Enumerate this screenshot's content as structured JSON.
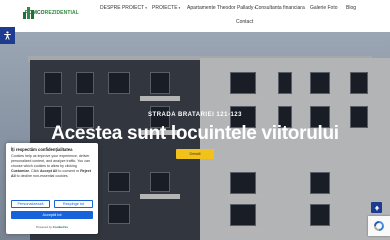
{
  "brand": {
    "logo_text_1": "ROMCO",
    "logo_text_2": "REZIDENTIAL"
  },
  "nav": {
    "items": [
      {
        "label": "DESPRE PROIECT",
        "has_caret": true
      },
      {
        "label": "PROIECTE",
        "has_caret": true
      },
      {
        "label": "Apartamente Theodor Pallady",
        "has_caret": true
      },
      {
        "label": "Consultanta financiara",
        "has_caret": false
      },
      {
        "label": "Galerie Foto",
        "has_caret": false
      },
      {
        "label": "Blog",
        "has_caret": false
      },
      {
        "label": "Contact",
        "has_caret": false
      }
    ]
  },
  "hero": {
    "subtitle": "STRADA BRATARIEI 121-123",
    "title": "Acestea sunt locuintele viitorului",
    "button_label": "Detalii"
  },
  "cookie": {
    "title": "Îți respectăm confidențialitatea",
    "text_1": "Cookies help us improve your experience, deliver personalized content, and analyze traffic. You can choose which cookies to allow by clicking ",
    "text_customize": "Customize",
    "text_2": ". Click ",
    "text_accept": "Accept All",
    "text_3": " to consent or ",
    "text_reject": "Reject All",
    "text_4": " to decline non-essential cookies.",
    "customize_label": "Personalizează",
    "reject_label": "Respinge tot",
    "accept_label": "Acceptă tot",
    "powered_prefix": "Powered by",
    "powered_brand": "CookieYes"
  },
  "colors": {
    "accent": "#f2c21b",
    "brand_blue": "#1d3b8f",
    "cookie_blue": "#1863dc"
  },
  "icons": {
    "accessibility": "accessibility-icon",
    "scroll_top": "arrow-up-icon",
    "recaptcha": "recaptcha-icon"
  }
}
